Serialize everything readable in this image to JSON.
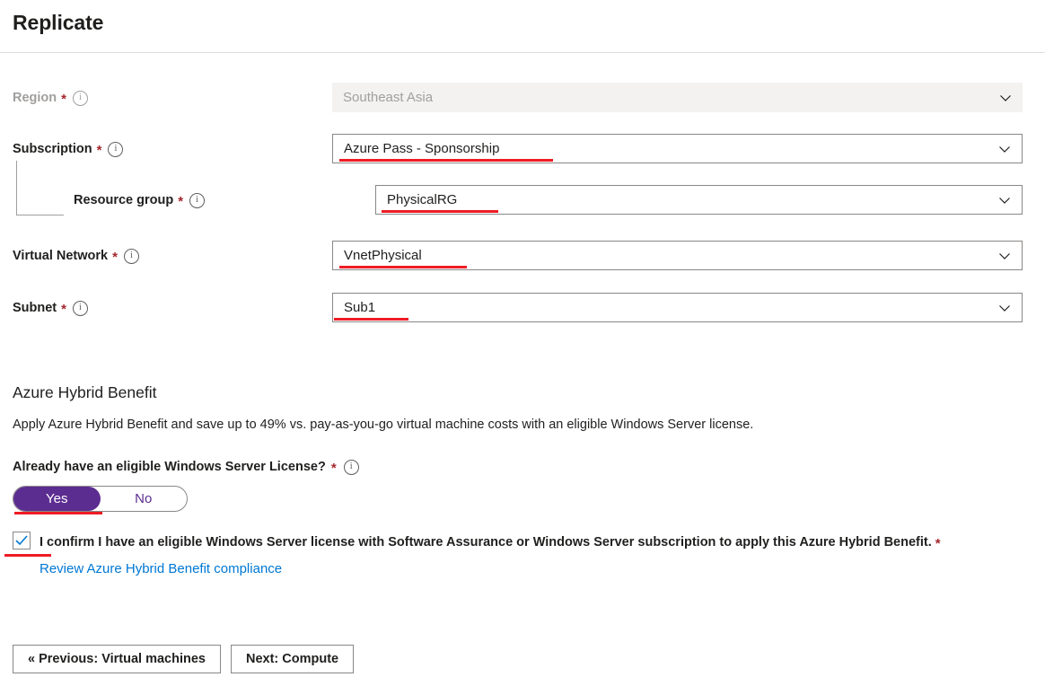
{
  "header": {
    "title": "Replicate"
  },
  "form": {
    "fields": [
      {
        "label": "Region",
        "required_mark": "*",
        "value": "Southeast Asia",
        "disabled": true
      },
      {
        "label": "Subscription",
        "required_mark": "*",
        "value": "Azure Pass - Sponsorship",
        "disabled": false
      },
      {
        "label": "Resource group",
        "required_mark": "*",
        "value": "PhysicalRG",
        "disabled": false
      },
      {
        "label": "Virtual Network",
        "required_mark": "*",
        "value": "VnetPhysical",
        "disabled": false
      },
      {
        "label": "Subnet",
        "required_mark": "*",
        "value": "Sub1",
        "disabled": false
      }
    ]
  },
  "hybrid_benefit": {
    "section_title": "Azure Hybrid Benefit",
    "description": "Apply Azure Hybrid Benefit and save up to 49% vs. pay-as-you-go virtual machine costs with an eligible Windows Server license.",
    "question": "Already have an eligible Windows Server License?",
    "question_required_mark": "*",
    "toggle": {
      "yes_label": "Yes",
      "no_label": "No",
      "selected": "Yes"
    },
    "confirm_checkbox": {
      "checked": true,
      "text": "I confirm I have an eligible Windows Server license with Software Assurance  or Windows Server subscription to apply this Azure Hybrid Benefit.",
      "required_mark": "*"
    },
    "compliance_link": "Review Azure Hybrid Benefit compliance"
  },
  "footer": {
    "previous_label": "« Previous: Virtual machines",
    "next_label": "Next: Compute"
  },
  "icons": {
    "info": "i",
    "chevron_down": "chevron-down-icon",
    "checkmark": "checkmark-icon"
  },
  "colors": {
    "accent_purple": "#5c2d91",
    "link_blue": "#0078d4",
    "required_red": "#a4262c",
    "annotation_red": "#ee1c25",
    "disabled_bg": "#f3f2f1",
    "border_grey": "#8a8886"
  }
}
